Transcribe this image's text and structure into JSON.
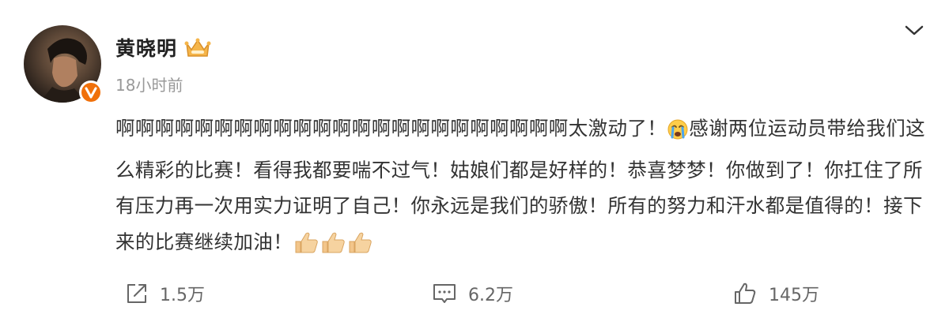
{
  "user": {
    "name": "黄晓明",
    "badge_icon": "crown-icon",
    "verified_icon": "verified-v-icon",
    "verified_color": "#f0700a"
  },
  "post": {
    "time": "18小时前",
    "text_part1": "啊啊啊啊啊啊啊啊啊啊啊啊啊啊啊啊啊啊啊啊啊啊啊太激动了！",
    "emoji_crying": "crying-face-icon",
    "text_part2": "感谢两位运动员带给我们这么精彩的比赛！看得我都要喘不过气！姑娘们都是好样的！恭喜梦梦！你做到了！你扛住了所有压力再一次用实力证明了自己！你永远是我们的骄傲！所有的努力和汗水都是值得的！接下来的比赛继续加油！",
    "emoji_thumbs": [
      "thumbs-up-icon",
      "thumbs-up-icon",
      "thumbs-up-icon"
    ]
  },
  "actions": {
    "repost_count": "1.5万",
    "comment_count": "6.2万",
    "like_count": "145万"
  },
  "colors": {
    "text": "#333333",
    "muted": "#999999",
    "action": "#666666"
  }
}
